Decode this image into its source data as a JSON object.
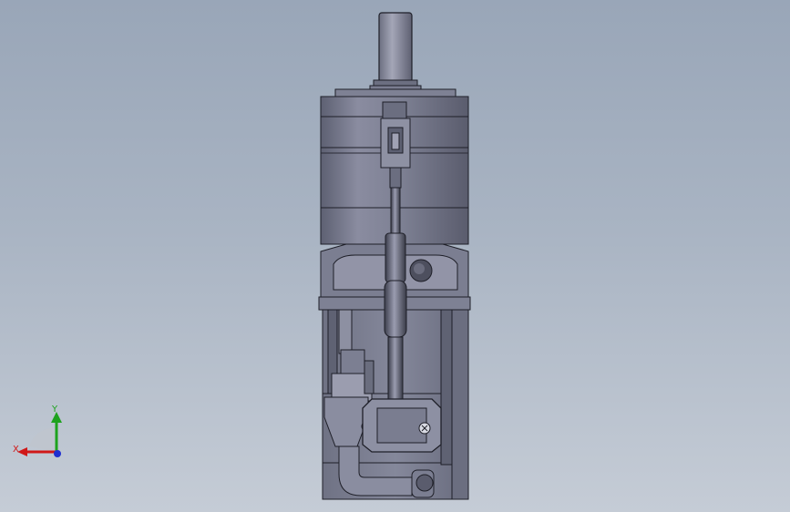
{
  "viewport": {
    "background_top": "#99a6b8",
    "background_bottom": "#c5ccd6"
  },
  "model": {
    "body_color": "#7c7f92",
    "edge_color": "#1e1f28"
  },
  "triad": {
    "x_label": "X",
    "y_label": "Y",
    "x_color": "#d01818",
    "y_color": "#1ea21e",
    "z_color": "#1f2fd0"
  }
}
